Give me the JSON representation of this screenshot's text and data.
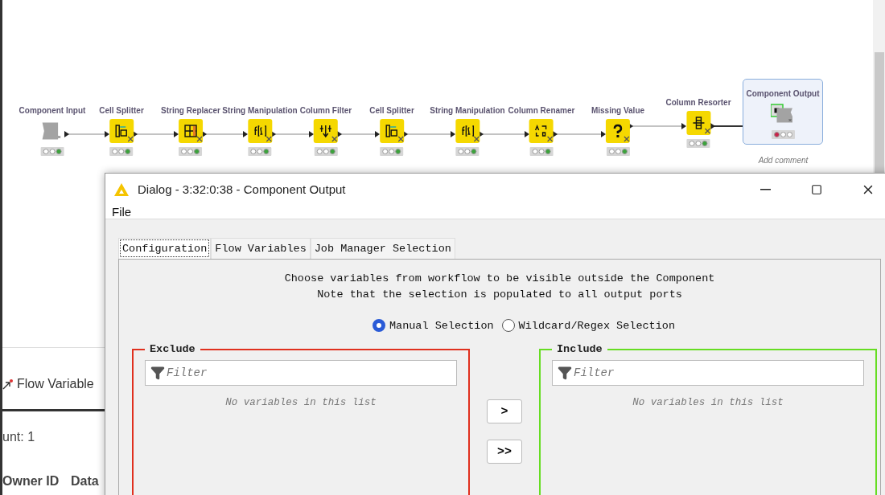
{
  "workflow": {
    "nodes": [
      {
        "label": "Component Input",
        "kind": "component_input",
        "executed": true,
        "selected": false
      },
      {
        "label": "Cell Splitter",
        "kind": "splitter",
        "executed": true,
        "selected": false
      },
      {
        "label": "String Replacer",
        "kind": "replacer",
        "executed": true,
        "selected": false
      },
      {
        "label": "String Manipulation",
        "kind": "manipulation",
        "executed": true,
        "selected": false
      },
      {
        "label": "Column Filter",
        "kind": "filter",
        "executed": true,
        "selected": false
      },
      {
        "label": "Cell Splitter",
        "kind": "splitter",
        "executed": true,
        "selected": false
      },
      {
        "label": "String Manipulation",
        "kind": "manipulation",
        "executed": true,
        "selected": false
      },
      {
        "label": "Column Renamer",
        "kind": "renamer",
        "executed": true,
        "selected": false
      },
      {
        "label": "Missing Value",
        "kind": "missing",
        "executed": true,
        "selected": false
      },
      {
        "label": "Column Resorter",
        "kind": "resorter",
        "executed": true,
        "selected": false
      },
      {
        "label": "Component Output",
        "kind": "component_output",
        "executed": false,
        "selected": true
      }
    ],
    "comment_placeholder": "Add comment"
  },
  "background_panel": {
    "tab": "Flow Variable",
    "count": "unt: 1",
    "columns": [
      "Owner ID",
      "Data"
    ]
  },
  "dialog": {
    "title": "Dialog - 3:32:0:38 - Component Output",
    "menu": [
      "File"
    ],
    "tabs": [
      {
        "label": "Configuration",
        "selected": true
      },
      {
        "label": "Flow Variables",
        "selected": false
      },
      {
        "label": "Job Manager Selection",
        "selected": false
      }
    ],
    "description": [
      "Choose variables from workflow to be visible outside the Component",
      "Note that the selection is populated to all output ports"
    ],
    "modes": [
      {
        "label": "Manual Selection",
        "selected": true
      },
      {
        "label": "Wildcard/Regex Selection",
        "selected": false
      }
    ],
    "lists": [
      {
        "title": "Exclude",
        "color": "#e0301e",
        "placeholder": "Filter",
        "empty": "No variables in this list"
      },
      {
        "title": "Include",
        "color": "#66dd22",
        "placeholder": "Filter",
        "empty": "No variables in this list"
      }
    ],
    "move_buttons": [
      ">",
      ">>"
    ]
  }
}
